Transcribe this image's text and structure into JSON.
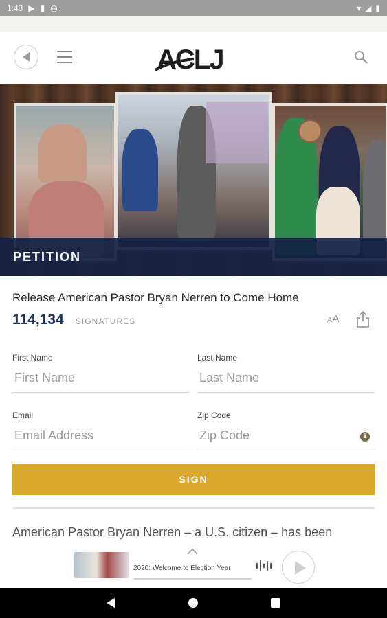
{
  "status_bar": {
    "time": "1:43"
  },
  "header": {
    "logo_text": "ACLJ"
  },
  "hero": {
    "band_label": "PETITION"
  },
  "petition": {
    "title": "Release American Pastor Bryan Nerren to Come Home",
    "signature_count": "114,134",
    "signature_label": "SIGNATURES",
    "font_size_small": "A",
    "font_size_large": "A"
  },
  "form": {
    "first_name": {
      "label": "First Name",
      "placeholder": "First Name",
      "value": ""
    },
    "last_name": {
      "label": "Last Name",
      "placeholder": "Last Name",
      "value": ""
    },
    "email": {
      "label": "Email",
      "placeholder": "Email Address",
      "value": ""
    },
    "zip": {
      "label": "Zip Code",
      "placeholder": "Zip Code",
      "value": ""
    },
    "info_glyph": "i",
    "sign_label": "SIGN"
  },
  "body": {
    "text": "American Pastor Bryan Nerren – a U.S. citizen – has been"
  },
  "player": {
    "episode_title": "2020: Welcome to Election Year"
  },
  "colors": {
    "navy": "#1d3565",
    "gold": "#dba82f",
    "band": "#122242"
  }
}
